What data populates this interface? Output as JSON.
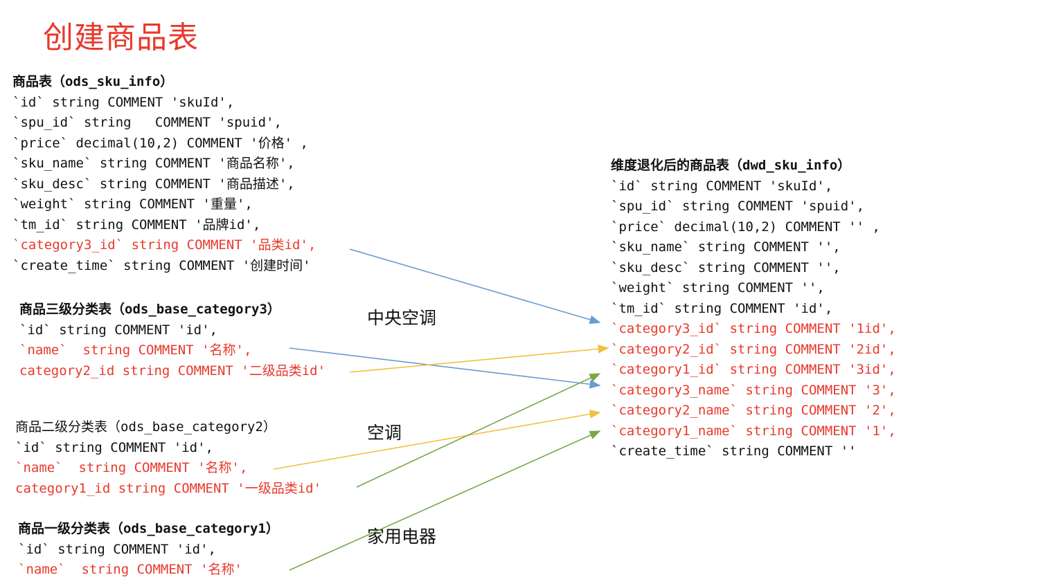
{
  "title": "创建商品表",
  "sku_info": {
    "header": "商品表（ods_sku_info）",
    "lines": [
      {
        "text": "`id` string COMMENT 'skuId',",
        "red": false
      },
      {
        "text": "`spu_id` string   COMMENT 'spuid',",
        "red": false
      },
      {
        "text": "`price` decimal(10,2) COMMENT '价格' ,",
        "red": false
      },
      {
        "text": "`sku_name` string COMMENT '商品名称',",
        "red": false
      },
      {
        "text": "`sku_desc` string COMMENT '商品描述',",
        "red": false
      },
      {
        "text": "`weight` string COMMENT '重量',",
        "red": false
      },
      {
        "text": "`tm_id` string COMMENT '品牌id',",
        "red": false
      },
      {
        "text": "`category3_id` string COMMENT '品类id',",
        "red": true
      },
      {
        "text": "`create_time` string COMMENT '创建时间'",
        "red": false
      }
    ]
  },
  "category3": {
    "header": "商品三级分类表（ods_base_category3）",
    "lines": [
      {
        "text": "`id` string COMMENT 'id',",
        "red": false
      },
      {
        "text": "`name`  string COMMENT '名称',",
        "red": true
      },
      {
        "text": "category2_id string COMMENT '二级品类id'",
        "red": true
      }
    ]
  },
  "category2": {
    "header": "商品二级分类表（ods_base_category2）",
    "lines": [
      {
        "text": "`id` string COMMENT 'id',",
        "red": false
      },
      {
        "text": "`name`  string COMMENT '名称',",
        "red": true
      },
      {
        "text": "category1_id string COMMENT '一级品类id'",
        "red": true
      }
    ]
  },
  "category1": {
    "header": "商品一级分类表（ods_base_category1）",
    "lines": [
      {
        "text": "`id` string COMMENT 'id',",
        "red": false
      },
      {
        "text": "`name`  string COMMENT '名称'",
        "red": true
      }
    ]
  },
  "dwd_sku_info": {
    "header": "维度退化后的商品表（dwd_sku_info）",
    "lines": [
      {
        "text": "`id` string COMMENT 'skuId',",
        "red": false
      },
      {
        "text": "`spu_id` string COMMENT 'spuid',",
        "red": false
      },
      {
        "text": "`price` decimal(10,2) COMMENT '' ,",
        "red": false
      },
      {
        "text": "`sku_name` string COMMENT '',",
        "red": false
      },
      {
        "text": "`sku_desc` string COMMENT '',",
        "red": false
      },
      {
        "text": "`weight` string COMMENT '',",
        "red": false
      },
      {
        "text": "`tm_id` string COMMENT 'id',",
        "red": false
      },
      {
        "text": "`category3_id` string COMMENT '1id',",
        "red": true
      },
      {
        "text": "`category2_id` string COMMENT '2id',",
        "red": true
      },
      {
        "text": "`category1_id` string COMMENT '3id',",
        "red": true
      },
      {
        "text": "`category3_name` string COMMENT '3',",
        "red": true
      },
      {
        "text": "`category2_name` string COMMENT '2',",
        "red": true
      },
      {
        "text": "`category1_name` string COMMENT '1',",
        "red": true
      },
      {
        "text": "`create_time` string COMMENT ''",
        "red": false
      }
    ]
  },
  "example_labels": {
    "level3": "中央空调",
    "level2": "空调",
    "level1": "家用电器"
  },
  "arrow_colors": {
    "blue": "#6a9bd1",
    "yellow": "#f2c040",
    "green": "#77a84a"
  }
}
